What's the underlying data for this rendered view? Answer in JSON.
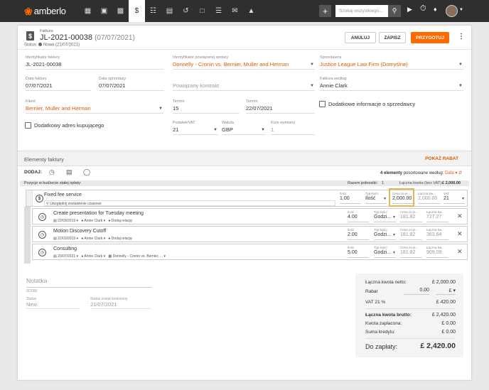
{
  "topbar": {
    "brand": "amberlo",
    "search_placeholder": "Szukaj wszystkiego..."
  },
  "header": {
    "kind": "Faktura",
    "number": "JL-2021-00038",
    "date_suffix": "(07/07/2021)",
    "status_label": "Status:",
    "status_value": "Nowa (21/07/2021)"
  },
  "actions": {
    "cancel": "ANULUJ",
    "save": "ZAPISZ",
    "prepare": "PRZYGOTUJ"
  },
  "fields": {
    "invoice_id_label": "Identyfikator faktury",
    "invoice_id": "JL-2021-00038",
    "matter_id_label": "Identyfikator powiązanej sprawy",
    "matter": "Donnelly - Cronin vs. Bernier, Muller and Herman",
    "seller_label": "Sprzedawca",
    "seller": "Justice League Law Firm (Domyślne)",
    "invoice_date_label": "Data faktury",
    "invoice_date": "07/07/2021",
    "sale_date_label": "Data sprzedaży",
    "sale_date": "07/07/2021",
    "related_contract": "Powiązany kontrakt",
    "prepared_by_label": "Faktura według",
    "prepared_by": "Annie Clark",
    "client_label": "Klient",
    "client": "Bernier, Muller and Herman",
    "term_days_label": "Termin",
    "term_days": "15",
    "due_date_label": "Termin",
    "due_date": "22/07/2021",
    "seller_info": "Dodatkowe informacje o sprzedawcy",
    "buyer_address": "Dodatkowy adres kupującego",
    "tax_label": "Podatek/VAT",
    "tax": "21",
    "currency_label": "Waluta",
    "currency": "GBP",
    "rate_label": "Kurs wymiany",
    "rate": "1"
  },
  "elements": {
    "title": "Elementy faktury",
    "show_discount": "POKAŻ RABAT",
    "add_label": "DODAJ:",
    "sort_count": "4 elementy",
    "sort_text": "posortowane według:",
    "sort_field": "Data",
    "strip_left": "Pozycje w budżecie stałej opłaty:",
    "units_label": "Razem jednostki:",
    "units": "1",
    "net_total_label": "Łączna kwota (bez VAT):",
    "net_total": "£ 2,000.00"
  },
  "fixed_fee": {
    "title": "Fixed fee service",
    "sub": "Uwzględnij zestawienie czasowe",
    "qty_label": "Ilość",
    "qty": "1.00",
    "type_label": "Typ ilości",
    "type": "Ilość",
    "price_label": "Cena za je...",
    "price": "2,000.00",
    "total_label": "Łączna kw...",
    "total": "2,000.00",
    "vat_label": "VAT",
    "vat": "21"
  },
  "time_entries": [
    {
      "title": "Create presentation for Tuesday meeting",
      "date": "22/03/2019",
      "user": "Annie Clark",
      "relation": "Dodaj relację",
      "qty_label": "Ilość",
      "qty": "4.00",
      "type_label": "Typ ilości",
      "type": "Godzi...",
      "price_label": "Cena za je...",
      "price": "181.82",
      "total_label": "Łączna kw...",
      "total": "727.27"
    },
    {
      "title": "Motion Discovery Cutoff",
      "date": "22/03/2019",
      "user": "Annie Clark",
      "relation": "Dodaj relację",
      "qty_label": "Ilość",
      "qty": "2.00",
      "type_label": "Typ ilości",
      "type": "Godzi...",
      "price_label": "Cena za je...",
      "price": "181.82",
      "total_label": "Łączna kw...",
      "total": "363.64"
    },
    {
      "title": "Consulting",
      "date": "20/07/2021",
      "user": "Annie Clark",
      "relation": "Donnelly - Cronin vs. Bernier, ...",
      "qty_label": "Ilość",
      "qty": "5.00",
      "type_label": "Typ ilości",
      "type": "Godzi...",
      "price_label": "Cena za je...",
      "price": "181.82",
      "total_label": "Łączna kw...",
      "total": "909.09"
    }
  ],
  "notes": {
    "title": "Notatka",
    "counter": "0/2000",
    "status_label": "Status",
    "status": "New",
    "changed_label": "Status został zmieniony",
    "changed": "21/07/2021"
  },
  "totals": {
    "net_label": "Łączna kwota netto:",
    "net": "£ 2,000.00",
    "discount_label": "Rabat",
    "discount": "0.00",
    "discount_unit": "£",
    "vat_label": "VAT 21 %",
    "vat": "£ 420.00",
    "gross_label": "Łączna kwota brutto:",
    "gross": "£ 2,420.00",
    "paid_label": "Kwota zapłacona:",
    "paid": "£ 0.00",
    "credit_label": "Suma kredytu:",
    "credit": "£ 0.00",
    "due_label": "Do zapłaty:",
    "due": "£ 2,420.00"
  },
  "colors": {
    "accent": "#ff6a00",
    "topbar": "#2f2f2f",
    "highlight": "#e6b84f"
  }
}
